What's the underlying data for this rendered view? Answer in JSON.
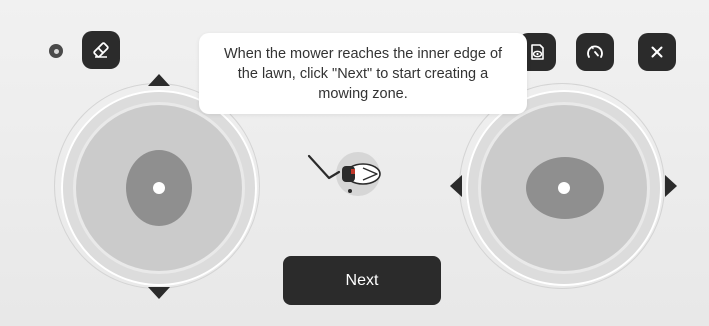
{
  "hint": {
    "text": "When the mower reaches the inner edge of the lawn, click \"Next\" to start creating a mowing zone."
  },
  "toolbar": {
    "left": {
      "status_icon": "status-dot-icon",
      "eraser_icon": "eraser-icon"
    },
    "right": {
      "view_icon": "view-toggle-icon",
      "speed_icon": "speedometer-icon",
      "close_icon": "close-icon"
    }
  },
  "joysticks": {
    "left": {
      "axis": "vertical",
      "arrows": [
        "up",
        "down"
      ]
    },
    "right": {
      "axis": "horizontal",
      "arrows": [
        "left",
        "right"
      ]
    }
  },
  "mower": {
    "icon": "mower-icon"
  },
  "actions": {
    "next_label": "Next"
  },
  "colors": {
    "button_dark": "#2b2b2b",
    "background": "#ececec",
    "tooltip_bg": "#ffffff",
    "joystick_knob": "#8f8f8f"
  }
}
